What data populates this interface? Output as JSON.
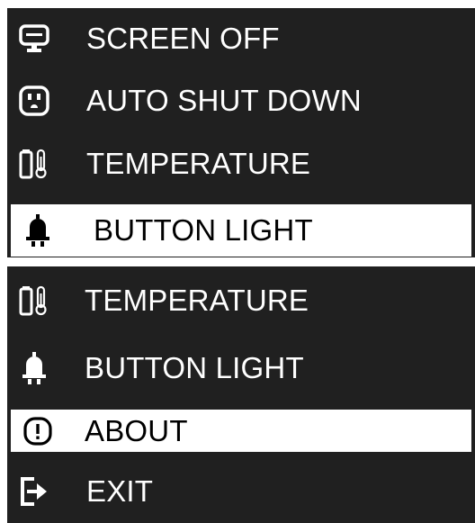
{
  "menu_top": {
    "items": [
      {
        "label": "SCREEN OFF",
        "icon": "monitor-icon"
      },
      {
        "label": "AUTO SHUT DOWN",
        "icon": "power-outlet-icon"
      },
      {
        "label": "TEMPERATURE",
        "icon": "battery-thermometer-icon"
      },
      {
        "label": "BUTTON LIGHT",
        "icon": "button-light-icon",
        "selected": true
      }
    ]
  },
  "menu_bottom": {
    "items": [
      {
        "label": "TEMPERATURE",
        "icon": "battery-thermometer-icon"
      },
      {
        "label": "BUTTON LIGHT",
        "icon": "button-light-icon"
      },
      {
        "label": "ABOUT",
        "icon": "info-exclamation-icon",
        "selected": true
      },
      {
        "label": "EXIT",
        "icon": "exit-icon"
      }
    ]
  },
  "colors": {
    "panel_bg": "#202020",
    "text": "#ffffff",
    "selected_bg": "#ffffff",
    "selected_text": "#000000"
  }
}
